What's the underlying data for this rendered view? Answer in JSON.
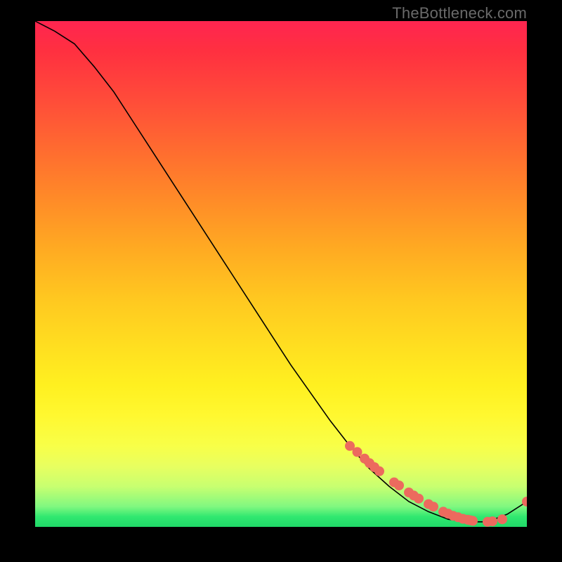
{
  "watermark": "TheBottleneck.com",
  "chart_data": {
    "type": "line",
    "title": "",
    "xlabel": "",
    "ylabel": "",
    "xlim": [
      0,
      100
    ],
    "ylim": [
      0,
      100
    ],
    "grid": false,
    "legend": false,
    "series": [
      {
        "name": "curve",
        "style": "line",
        "color": "#000000",
        "x": [
          0,
          4,
          8,
          12,
          16,
          20,
          24,
          28,
          32,
          36,
          40,
          44,
          48,
          52,
          56,
          60,
          64,
          68,
          72,
          76,
          80,
          84,
          88,
          92,
          96,
          100
        ],
        "y": [
          100,
          98,
          95.5,
          91,
          86,
          80,
          74,
          68,
          62,
          56,
          50,
          44,
          38,
          32,
          26.5,
          21,
          16,
          11.5,
          8,
          5,
          3,
          1.5,
          1,
          1,
          2.5,
          5
        ]
      },
      {
        "name": "markers",
        "style": "scatter",
        "color": "#EC6A5E",
        "x": [
          64,
          65.5,
          67,
          68,
          69,
          70,
          73,
          74,
          76,
          77,
          78,
          80,
          81,
          83,
          84,
          85,
          86,
          87,
          88,
          88.5,
          89,
          92,
          93,
          95,
          100
        ],
        "y": [
          16,
          14.8,
          13.5,
          12.6,
          11.8,
          11,
          8.8,
          8.2,
          6.8,
          6.2,
          5.6,
          4.5,
          4.0,
          3.0,
          2.6,
          2.2,
          1.9,
          1.6,
          1.4,
          1.3,
          1.2,
          1.0,
          1.1,
          1.5,
          5
        ]
      }
    ],
    "background_gradient": {
      "direction": "vertical",
      "stops": [
        {
          "pos": 0.0,
          "color": "#FF2550"
        },
        {
          "pos": 0.5,
          "color": "#FFC820"
        },
        {
          "pos": 0.8,
          "color": "#FFF830"
        },
        {
          "pos": 0.96,
          "color": "#80F880"
        },
        {
          "pos": 1.0,
          "color": "#20D868"
        }
      ]
    }
  }
}
